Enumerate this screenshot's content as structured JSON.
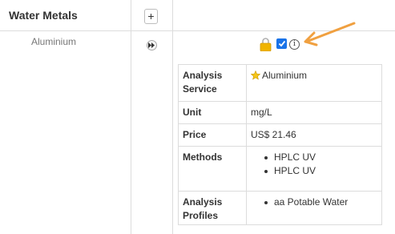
{
  "category": {
    "title": "Water Metals",
    "add_button_label": "+"
  },
  "service": {
    "name": "Aluminium",
    "icons": [
      "expand-icon",
      "lock-icon",
      "checkbox-checked",
      "info-icon"
    ],
    "checkbox_checked": true,
    "info_label": "i"
  },
  "details": {
    "analysis_service": {
      "label": "Analysis Service",
      "value": "Aluminium",
      "icon": "star-icon"
    },
    "unit": {
      "label": "Unit",
      "value": "mg/L"
    },
    "price": {
      "label": "Price",
      "value": "US$ 21.46"
    },
    "methods": {
      "label": "Methods",
      "items": [
        "HPLC UV",
        "HPLC UV"
      ]
    },
    "analysis_profiles": {
      "label": "Analysis Profiles",
      "items": [
        "aa Potable Water"
      ]
    }
  },
  "colors": {
    "checkbox": "#1a73e8",
    "lock": "#f0b400",
    "annotation_arrow": "#f0a040",
    "grid": "#dcdcdc"
  }
}
